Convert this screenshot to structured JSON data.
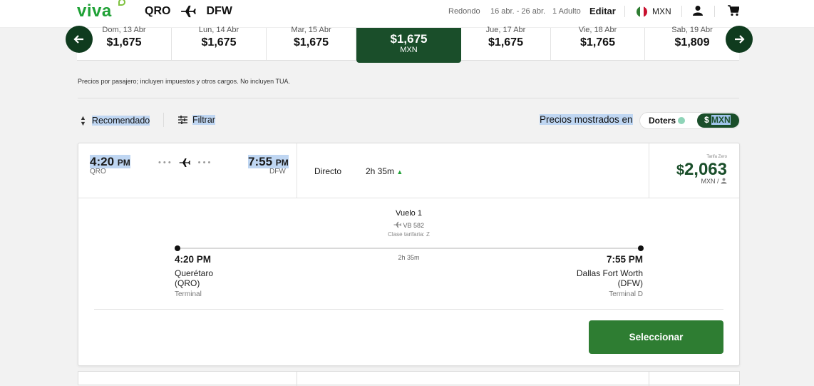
{
  "header": {
    "logo": "viva",
    "origin": "QRO",
    "destination": "DFW",
    "trip_type": "Redondo",
    "dates": "16 abr. - 26 abr.",
    "passengers": "1 Adulto",
    "edit_label": "Editar",
    "currency": "MXN",
    "icons": [
      "airplane-icon",
      "flag-mexico-icon",
      "user-icon",
      "cart-icon"
    ]
  },
  "date_strip": {
    "prev_icon": "arrow-left-icon",
    "next_icon": "arrow-right-icon",
    "days": [
      {
        "label": "Dom, 13 Abr",
        "price": "$1,675"
      },
      {
        "label": "Lun, 14 Abr",
        "price": "$1,675"
      },
      {
        "label": "Mar, 15 Abr",
        "price": "$1,675"
      },
      {
        "label": "",
        "price": "$1,675",
        "currency": "MXN",
        "selected": true
      },
      {
        "label": "Jue, 17 Abr",
        "price": "$1,675"
      },
      {
        "label": "Vie, 18 Abr",
        "price": "$1,765"
      },
      {
        "label": "Sab, 19 Abr",
        "price": "$1,809"
      }
    ]
  },
  "disclaimer": "Precios por pasajero; incluyen impuestos y otros cargos. No incluyen TUA.",
  "toolbar": {
    "sort_label": "Recomendado",
    "filter_label": "Filtrar",
    "prices_shown_in": "Precios mostrados en",
    "toggle_doters": "Doters",
    "toggle_mxn_symbol": "$",
    "toggle_mxn": "MXN"
  },
  "flight": {
    "departure_time": "4:20",
    "departure_ampm": "PM",
    "departure_code": "QRO",
    "arrival_time": "7:55",
    "arrival_ampm": "PM",
    "arrival_code": "DFW",
    "stops": "Directo",
    "duration": "2h 35m",
    "fare_name": "Tarifa Zero",
    "price_symbol": "$",
    "price": "2,063",
    "price_unit": "MXN /",
    "details": {
      "segment": "Vuelo 1",
      "flight_number": "VB 582",
      "fare_class": "Clase tarifaria: Z",
      "segment_duration": "2h 35m",
      "dep_time": "4:20 PM",
      "dep_city": "Querétaro",
      "dep_city_code": "(QRO)",
      "dep_terminal": "Terminal",
      "arr_time": "7:55 PM",
      "arr_city": "Dallas Fort Worth",
      "arr_city_code": "(DFW)",
      "arr_terminal": "Terminal D"
    },
    "select_label": "Seleccionar"
  },
  "colors": {
    "brand_green": "#1fa136",
    "dark_green": "#1a4e2a",
    "button_green": "#2e7d32"
  }
}
